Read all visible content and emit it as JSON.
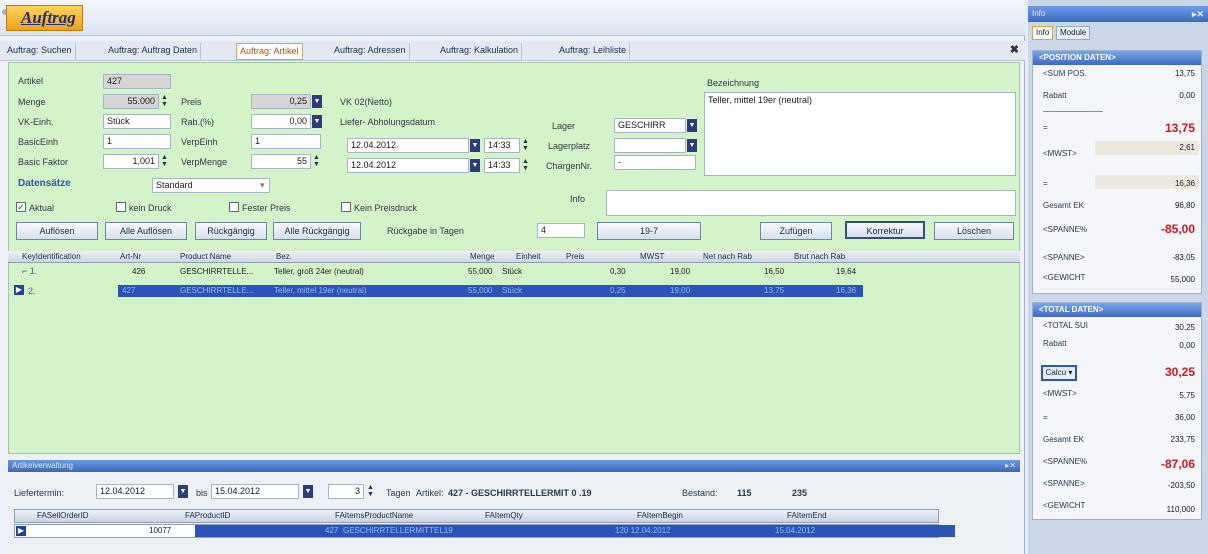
{
  "window": {
    "title": "Auftrag"
  },
  "tabs": [
    "Auftrag: Suchen",
    "Auftrag: Auftrag Daten",
    "Auftrag: Artikel",
    "Auftrag: Adressen",
    "Auftrag: Kalkulation",
    "Auftrag: Leihliste"
  ],
  "form": {
    "artikel_label": "Artikel",
    "artikel_value": "427",
    "menge_label": "Menge",
    "menge_value": "55.000",
    "vkeinh_label": "VK-Einh.",
    "vkeinh_value": "Stück",
    "basiceinh_label": "BasicEinh",
    "basiceinh_value": "1",
    "basicfaktor_label": "Basic Faktor",
    "basicfaktor_value": "1,001",
    "preis_label": "Preis",
    "preis_value": "0,25",
    "rab_label": "Rab.(%)",
    "rab_value": "0,00",
    "verpeinh_label": "VerpEinh",
    "verpeinh_value": "1",
    "verpmenge_label": "VerpMenge",
    "verpmenge_value": "55",
    "vk02_label": "VK 02(Netto)",
    "lieferabholung_label": "Liefer- Abholungsdatum",
    "date1": "12.04.2012",
    "time1": "14:33",
    "date2": "12.04.2012",
    "time2": "14:33",
    "lager_label": "Lager",
    "lager_value": "GESCHIRR",
    "lagerplatz_label": "Lagerplatz",
    "lagerplatz_value": "",
    "chargennr_label": "ChargenNr.",
    "chargennr_value": "-",
    "bezeichnung_label": "Bezeichnung",
    "bezeichnung_value": "Teller, mittel 19er (neutral)",
    "datensaetze_label": "Datensätze",
    "standard_value": "Standard",
    "info_label": "Info",
    "aktual_label": "Aktual",
    "keindruck_label": "kein Druck",
    "festerpreis_label": "Fester Preis",
    "keinpreisdruck_label": "Kein Preisdruck",
    "rueckgabe_label": "Rückgabe in Tagen",
    "rueckgabe_value": "4"
  },
  "buttons": {
    "aufloesen": "Auflösen",
    "alle_aufloesen": "Alle Auflösen",
    "rueckgaengig": "Rückgängig",
    "alle_rueckgaengig": "Alle Rückgängig",
    "btn_19_7": "19-7",
    "zufuegen": "Zufügen",
    "korrektur": "Korrektur",
    "loeschen": "Löschen"
  },
  "grid": {
    "headers": [
      "KeyIdentification",
      "Art-Nr",
      "Product Name",
      "Bez.",
      "Menge",
      "Einheit",
      "Preis",
      "MWST",
      "Net nach Rab",
      "Brut nach Rab"
    ],
    "rows": [
      {
        "key": "1.",
        "artnr": "426",
        "product": "GESCHIRRTELLE...",
        "bez": "Teller, groß 24er (neutral)",
        "menge": "55,000",
        "einheit": "Stück",
        "preis": "0,30",
        "mwst": "19,00",
        "net": "16,50",
        "brut": "19,64"
      },
      {
        "key": "2.",
        "artnr": "427",
        "product": "GESCHIRRTELLE...",
        "bez": "Teller, mittel 19er (neutral)",
        "menge": "55,000",
        "einheit": "Stück",
        "preis": "0,25",
        "mwst": "19,00",
        "net": "13,75",
        "brut": "16,36"
      }
    ]
  },
  "bottom": {
    "title": "Artikelverwaltung",
    "liefertermin_label": "Liefertermin:",
    "date_from": "12.04.2012",
    "bis_label": "bis",
    "date_to": "15.04.2012",
    "tage_value": "3",
    "tage_label": "Tagen",
    "artikel_label": "Artikel:",
    "artikel_value": "427 - GESCHIRRTELLERMIT 0 .19",
    "bestand_label": "Bestand:",
    "bestand_value": "115",
    "second_value": "235",
    "headers": [
      "FASellOrderID",
      "FAProductID",
      "FAItemsProductName",
      "FAItemQty",
      "FAItemBegin",
      "FAItemEnd"
    ],
    "row": {
      "id": "10077",
      "product_id": "427",
      "name": "GESCHIRRTELLERMITTEL19",
      "qty": "",
      "begin": "120 12.04.2012",
      "end": "15.04.2012"
    }
  },
  "right_panel": {
    "title": "Info",
    "tabs": [
      "Info",
      "Module"
    ],
    "position": {
      "header": "<POSITION DATEN>",
      "sum_pos_label": "<SUM POS.",
      "sum_pos": "13,75",
      "rabatt_label": "Rabatt",
      "rabatt": "0,00",
      "eq1_label": "=",
      "eq1": "13,75",
      "mwst_label": "<MWST>",
      "mwst": "2,61",
      "eq2_label": "=",
      "eq2": "16,36",
      "gesamt_label": "Gesamt EK",
      "gesamt": "96,80",
      "spanne_pct_label": "<SPANNE%",
      "spanne_pct": "-85,00",
      "spanne_label": "<SPANNE>",
      "spanne": "-83,05",
      "gewicht_label": "<GEWICHT",
      "gewicht": "55,000"
    },
    "total": {
      "header": "<TOTAL DATEN>",
      "total_sum_label": "<TOTAL SUI",
      "total_sum": "30,25",
      "rabatt_label": "Rabatt",
      "rabatt": "0,00",
      "calcu_label": "Calcu ▾",
      "calcu_value": "30,25",
      "mwst_label": "<MWST>",
      "mwst": "5,75",
      "eq_label": "=",
      "eq": "36,00",
      "gesamt_label": "Gesamt EK",
      "gesamt": "233,75",
      "spanne_pct_label": "<SPANNE%",
      "spanne_pct": "-87,06",
      "spanne_label": "<SPANNE>",
      "spanne": "-203,50",
      "gewicht_label": "<GEWICHT",
      "gewicht": "110,000"
    }
  }
}
